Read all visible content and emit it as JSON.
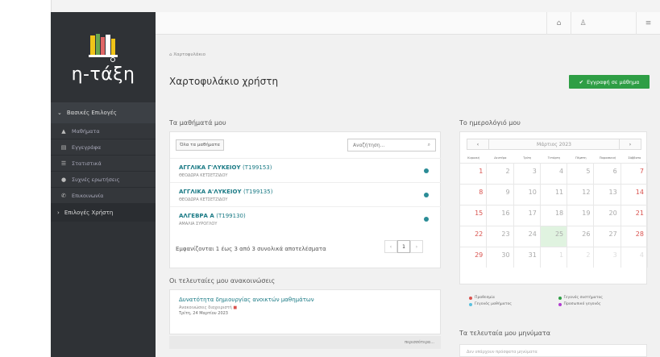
{
  "sidebar": {
    "logo_text": "η-τάξη",
    "basic_header": "Βασικές Επιλογές",
    "items": [
      {
        "label": "Μαθήματα",
        "icon": "graduation-cap-icon"
      },
      {
        "label": "Εγγεγράφα",
        "icon": "file-icon"
      },
      {
        "label": "Στατιστικά",
        "icon": "list-icon"
      },
      {
        "label": "Συχνές ερωτήσεις",
        "icon": "question-icon"
      },
      {
        "label": "Επικοινωνία",
        "icon": "phone-icon"
      }
    ],
    "user_header": "Επιλογές Χρήστη"
  },
  "topbar": {
    "home_icon": "home-icon",
    "user_icon": "user-icon",
    "settings_icon": "sliders-icon"
  },
  "page": {
    "breadcrumb": "Χαρτοφυλάκιο",
    "title": "Χαρτοφυλάκιο χρήστη",
    "enroll_label": "Εγγραφή σε μάθημα"
  },
  "courses": {
    "title": "Τα μαθήματά μου",
    "all_label": "Όλα τα μαθήματα",
    "search_placeholder": "Αναζήτηση...",
    "rows": [
      {
        "name": "ΑΓΓΛΙΚΑ Γ'ΛΥΚΕΙΟΥ",
        "code": "(Τ199153)",
        "teacher": "ΘΕΟΔΩΡΑ ΚΕΤΣΕΤΖΙΔΟΥ"
      },
      {
        "name": "ΑΓΓΛΙΚΑ Α'ΛΥΚΕΙΟΥ",
        "code": "(Τ199135)",
        "teacher": "ΘΕΟΔΩΡΑ ΚΕΤΣΕΤΖΙΔΟΥ"
      },
      {
        "name": "ΑΛΓΕΒΡΑ Α",
        "code": "(Τ199130)",
        "teacher": "ΑΜΑΛΙΑ ΣΥΡΟΓΛΟΥ"
      }
    ],
    "pager_text": "Εμφανίζονται 1 έως 3 από 3 συνολικά αποτελέσματα",
    "pager_prev": "‹",
    "pager_page": "1",
    "pager_next": "›"
  },
  "announcements": {
    "title": "Οι τελευταίες μου ανακοινώσεις",
    "item_title": "Δυνατότητα δημιουργίας ανοικτών μαθημάτων",
    "item_sub": "Ανακοινώσεις διαχειριστή",
    "item_date": "Τρίτη, 24 Μαρτίου 2023",
    "more": "περισσότερα..."
  },
  "calendar": {
    "title": "Το ημερολόγιό μου",
    "prev": "‹",
    "next": "›",
    "month": "Μάρτιος 2023",
    "dows": [
      "Κυριακή",
      "Δευτέρα",
      "Τρίτη",
      "Τετάρτη",
      "Πέμπτη",
      "Παρασκευή",
      "Σάββατο"
    ],
    "weeks": [
      [
        "1",
        "2",
        "3",
        "4",
        "5",
        "6",
        "7"
      ],
      [
        "8",
        "9",
        "10",
        "11",
        "12",
        "13",
        "14"
      ],
      [
        "15",
        "16",
        "17",
        "18",
        "19",
        "20",
        "21"
      ],
      [
        "22",
        "23",
        "24",
        "25",
        "26",
        "27",
        "28"
      ],
      [
        "29",
        "30",
        "31",
        "1",
        "2",
        "3",
        "4"
      ]
    ],
    "today": "25",
    "legend": [
      {
        "label": "Προθεσμία",
        "color": "#d9534f"
      },
      {
        "label": "Γεγονός συστήματος",
        "color": "#2e9e45"
      },
      {
        "label": "Γεγονός μαθήματος",
        "color": "#5bc0de"
      },
      {
        "label": "Προσωπικό γεγονός",
        "color": "#b13fd0"
      }
    ]
  },
  "messages": {
    "title": "Τα τελευταία μου μηνύματα",
    "empty": "Δεν υπάρχουν πρόσφατα μηνύματα"
  }
}
